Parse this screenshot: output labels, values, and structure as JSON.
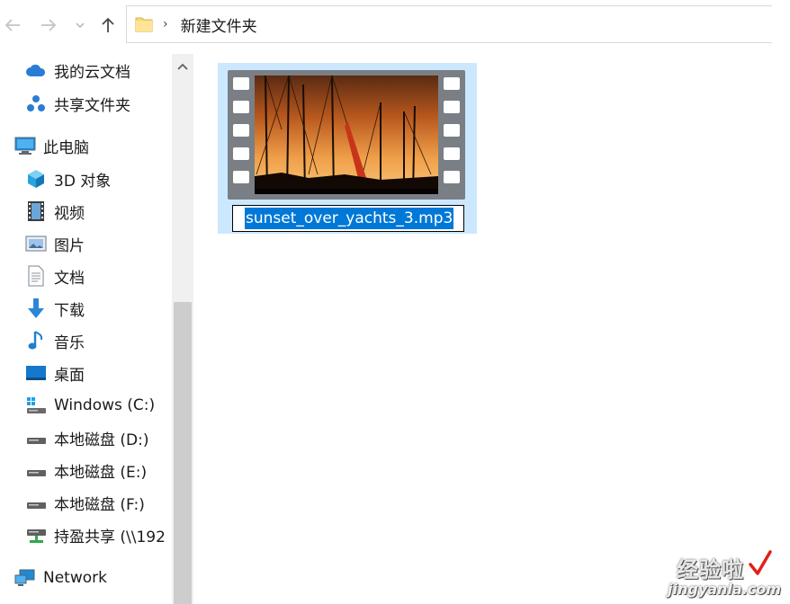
{
  "address_bar": {
    "path": [
      "新建文件夹"
    ]
  },
  "sidebar": {
    "items": [
      {
        "label": "我的云文档",
        "icon": "cloud-icon"
      },
      {
        "label": "共享文件夹",
        "icon": "share-icon"
      },
      {
        "label": "此电脑",
        "icon": "this-pc-icon"
      },
      {
        "label": "3D 对象",
        "icon": "3d-objects-icon"
      },
      {
        "label": "视频",
        "icon": "video-folder-icon"
      },
      {
        "label": "图片",
        "icon": "pictures-folder-icon"
      },
      {
        "label": "文档",
        "icon": "documents-folder-icon"
      },
      {
        "label": "下载",
        "icon": "download-arrow-icon"
      },
      {
        "label": "音乐",
        "icon": "music-note-icon"
      },
      {
        "label": "桌面",
        "icon": "desktop-icon"
      },
      {
        "label": "Windows (C:)",
        "icon": "system-drive-icon"
      },
      {
        "label": "本地磁盘 (D:)",
        "icon": "drive-icon"
      },
      {
        "label": "本地磁盘 (E:)",
        "icon": "drive-icon"
      },
      {
        "label": "本地磁盘 (F:)",
        "icon": "drive-icon"
      },
      {
        "label": "持盈共享 (\\\\192",
        "icon": "network-drive-icon"
      },
      {
        "label": "Network",
        "icon": "network-icon"
      }
    ]
  },
  "file": {
    "name": "sunset_over_yachts_3.mp3",
    "thumbnail": "video-thumbnail-sunset-yachts",
    "state": "renaming"
  },
  "watermark": {
    "line1": "经验啦",
    "line2": "jingyanla.com"
  },
  "colors": {
    "selection": "#cce8ff",
    "text_highlight": "#0078d7",
    "scrollbar_track": "#f0f0f0",
    "scrollbar_thumb": "#cdcdcd"
  }
}
